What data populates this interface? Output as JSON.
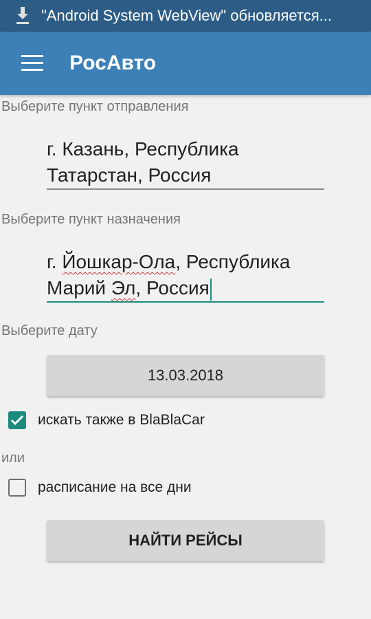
{
  "status_bar": {
    "notification_icon": "download-icon",
    "notification_text": "\"Android System WebView\" обновляется..."
  },
  "app_bar": {
    "menu_icon": "hamburger-menu-icon",
    "title": "РосАвто",
    "color": "#3d80b8"
  },
  "form": {
    "departure": {
      "label": "Выберите пункт отправления",
      "line1": "г. Казань, Республика",
      "line2": "Татарстан, Россия"
    },
    "destination": {
      "label": "Выберите пункт назначения",
      "line1_prefix": "г. ",
      "line1_word": "Йошкар-Ола",
      "line1_suffix": ", Республика",
      "line2_prefix": "Марий ",
      "line2_word": "Эл",
      "line2_suffix": ", Россия"
    },
    "date": {
      "label": "Выберите дату",
      "value": "13.03.2018"
    },
    "blablacar": {
      "label": "искать также в BlaBlaCar",
      "checked": true
    },
    "or_text": "или",
    "all_days": {
      "label": "расписание на все дни",
      "checked": false
    },
    "search_button": "НАЙТИ РЕЙСЫ"
  },
  "colors": {
    "accent": "#1d8a7e",
    "status_bar": "#2d5d86"
  }
}
